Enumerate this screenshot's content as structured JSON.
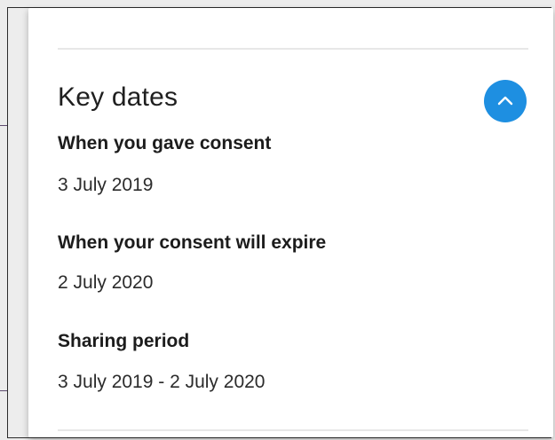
{
  "section": {
    "title": "Key dates",
    "toggle_icon": "chevron-up-icon",
    "accent_color": "#1e8fe1"
  },
  "dates": [
    {
      "label": "When you gave consent",
      "value": "3 July 2019"
    },
    {
      "label": "When your consent will expire",
      "value": "2 July 2020"
    },
    {
      "label": "Sharing period",
      "value": "3 July 2019 - 2 July 2020"
    }
  ]
}
